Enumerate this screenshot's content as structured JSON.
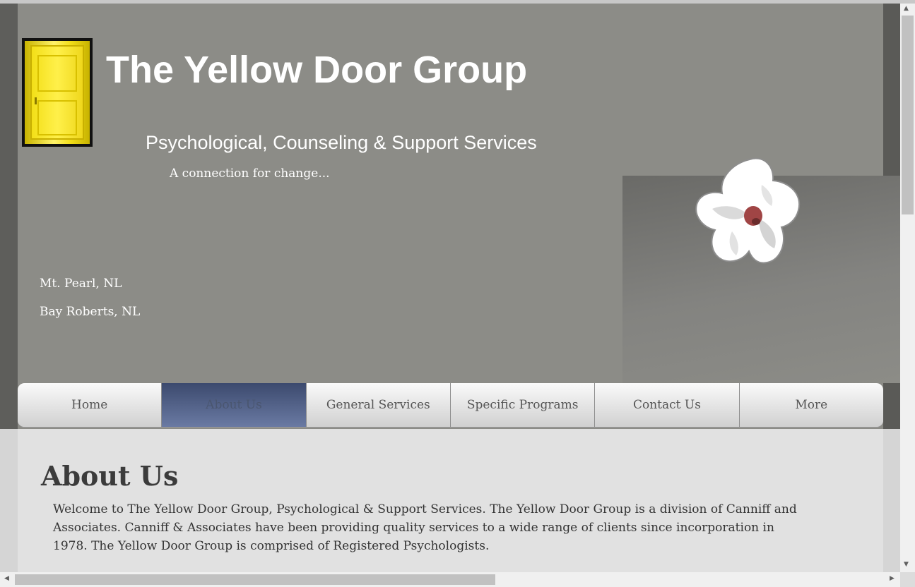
{
  "header": {
    "title": "The Yellow Door Group",
    "subtitle": "Psychological, Counseling & Support Services",
    "tagline": "A connection for change...",
    "locations": [
      "Mt. Pearl, NL",
      "Bay Roberts, NL"
    ]
  },
  "nav": {
    "items": [
      {
        "label": "Home"
      },
      {
        "label": "About Us"
      },
      {
        "label": "General Services"
      },
      {
        "label": "Specific Programs"
      },
      {
        "label": "Contact Us"
      },
      {
        "label": "More"
      }
    ],
    "active": "About Us"
  },
  "main": {
    "heading": "About Us",
    "body": "Welcome to The Yellow Door Group, Psychological & Support Services. The Yellow Door Group is a division of Canniff and Associates. Canniff & Associates have been providing quality services to a wide range of clients since incorporation in 1978. The Yellow Door Group is comprised of Registered Psychologists."
  },
  "icons": {
    "logo": "yellow-door-icon",
    "flower": "white-flower-image",
    "scroll_up": "arrow-up-icon",
    "scroll_down": "arrow-down-icon",
    "scroll_left": "arrow-left-icon",
    "scroll_right": "arrow-right-icon"
  },
  "colors": {
    "header_bg": "#8c8c87",
    "nav_active": "#4f5d84",
    "content_bg": "#e1e1e1",
    "door_yellow": "#f5e12a"
  }
}
